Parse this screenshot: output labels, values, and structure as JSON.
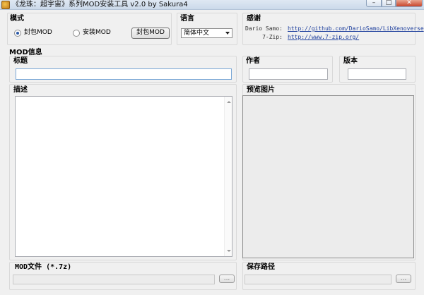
{
  "window": {
    "title": "《龙珠：超宇宙》系列MOD安装工具 v2.0 by Sakura4",
    "min_glyph": "–",
    "max_glyph": "□",
    "close_glyph": "✕"
  },
  "mode": {
    "label": "模式",
    "options": [
      "封包MOD",
      "安装MOD"
    ],
    "selected": "封包MOD",
    "action_button": "封包MOD"
  },
  "language": {
    "label": "语言",
    "selected": "简体中文"
  },
  "thanks": {
    "label": "感谢",
    "entries": [
      {
        "name": "Dario Samo:",
        "link": "http://github.com/DarioSamo/LibXenoverse"
      },
      {
        "name": "7-Zip:",
        "link": "http://www.7-zip.org/"
      }
    ]
  },
  "mod_info": {
    "label": "MOD信息",
    "title_label": "标题",
    "title_value": "",
    "author_label": "作者",
    "author_value": "",
    "version_label": "版本",
    "version_value": "",
    "description_label": "描述",
    "description_value": "",
    "preview_label": "预览图片"
  },
  "mod_file": {
    "label": "MOD文件 (*.7z)",
    "value": "",
    "browse_button": "..."
  },
  "save_path": {
    "label": "保存路径",
    "value": "",
    "browse_button": "..."
  },
  "colors": {
    "link": "#1b3d9c",
    "radio_selected": "#2c5aa8",
    "window_bg": "#f0f0f0",
    "close_button": "#c8452b"
  }
}
